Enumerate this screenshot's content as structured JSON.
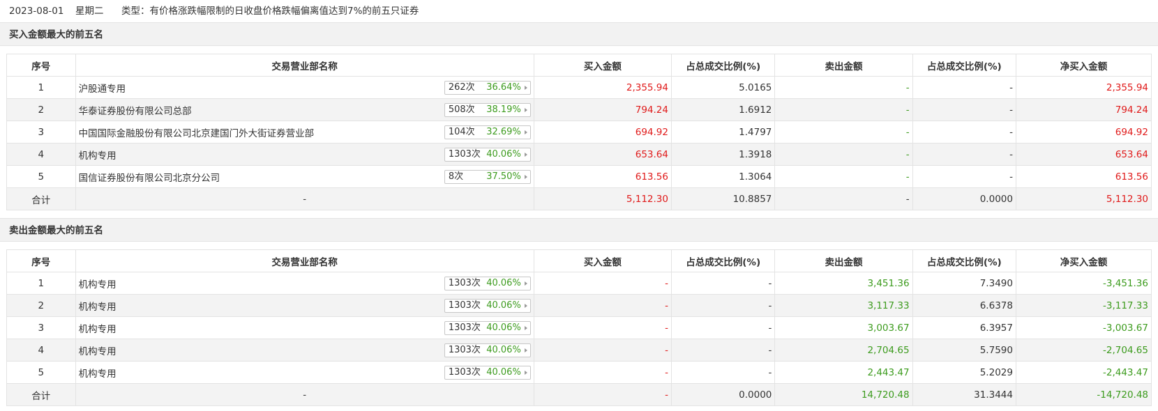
{
  "header": {
    "date": "2023-08-01",
    "weekday": "星期二",
    "type_text": "类型：有价格涨跌幅限制的日收盘价格跌幅偏离值达到7%的前五只证券"
  },
  "columns": [
    "序号",
    "交易营业部名称",
    "买入金额",
    "占总成交比例(%)",
    "卖出金额",
    "占总成交比例(%)",
    "净买入金额"
  ],
  "buy_section": {
    "title": "买入金额最大的前五名",
    "rows": [
      {
        "no": "1",
        "name": "沪股通专用",
        "count": "262次",
        "pct": "36.64%",
        "buy": "2,355.94",
        "buy_ratio": "5.0165",
        "sell": "-",
        "sell_ratio": "-",
        "net": "2,355.94"
      },
      {
        "no": "2",
        "name": "华泰证券股份有限公司总部",
        "count": "508次",
        "pct": "38.19%",
        "buy": "794.24",
        "buy_ratio": "1.6912",
        "sell": "-",
        "sell_ratio": "-",
        "net": "794.24"
      },
      {
        "no": "3",
        "name": "中国国际金融股份有限公司北京建国门外大街证券营业部",
        "count": "104次",
        "pct": "32.69%",
        "buy": "694.92",
        "buy_ratio": "1.4797",
        "sell": "-",
        "sell_ratio": "-",
        "net": "694.92"
      },
      {
        "no": "4",
        "name": "机构专用",
        "count": "1303次",
        "pct": "40.06%",
        "buy": "653.64",
        "buy_ratio": "1.3918",
        "sell": "-",
        "sell_ratio": "-",
        "net": "653.64"
      },
      {
        "no": "5",
        "name": "国信证券股份有限公司北京分公司",
        "count": "8次",
        "pct": "37.50%",
        "buy": "613.56",
        "buy_ratio": "1.3064",
        "sell": "-",
        "sell_ratio": "-",
        "net": "613.56"
      }
    ],
    "total": {
      "label": "合计",
      "name": "-",
      "buy": "5,112.30",
      "buy_ratio": "10.8857",
      "sell": "-",
      "sell_ratio": "0.0000",
      "net": "5,112.30"
    }
  },
  "sell_section": {
    "title": "卖出金额最大的前五名",
    "rows": [
      {
        "no": "1",
        "name": "机构专用",
        "count": "1303次",
        "pct": "40.06%",
        "buy": "-",
        "buy_ratio": "-",
        "sell": "3,451.36",
        "sell_ratio": "7.3490",
        "net": "-3,451.36"
      },
      {
        "no": "2",
        "name": "机构专用",
        "count": "1303次",
        "pct": "40.06%",
        "buy": "-",
        "buy_ratio": "-",
        "sell": "3,117.33",
        "sell_ratio": "6.6378",
        "net": "-3,117.33"
      },
      {
        "no": "3",
        "name": "机构专用",
        "count": "1303次",
        "pct": "40.06%",
        "buy": "-",
        "buy_ratio": "-",
        "sell": "3,003.67",
        "sell_ratio": "6.3957",
        "net": "-3,003.67"
      },
      {
        "no": "4",
        "name": "机构专用",
        "count": "1303次",
        "pct": "40.06%",
        "buy": "-",
        "buy_ratio": "-",
        "sell": "2,704.65",
        "sell_ratio": "5.7590",
        "net": "-2,704.65"
      },
      {
        "no": "5",
        "name": "机构专用",
        "count": "1303次",
        "pct": "40.06%",
        "buy": "-",
        "buy_ratio": "-",
        "sell": "2,443.47",
        "sell_ratio": "5.2029",
        "net": "-2,443.47"
      }
    ],
    "total": {
      "label": "合计",
      "name": "-",
      "buy": "-",
      "buy_ratio": "0.0000",
      "sell": "14,720.48",
      "sell_ratio": "31.3444",
      "net": "-14,720.48"
    }
  },
  "colors": {
    "positive": "#e01a1a",
    "negative": "#3c9b1d",
    "stat_pct": "#3c9b1d"
  }
}
